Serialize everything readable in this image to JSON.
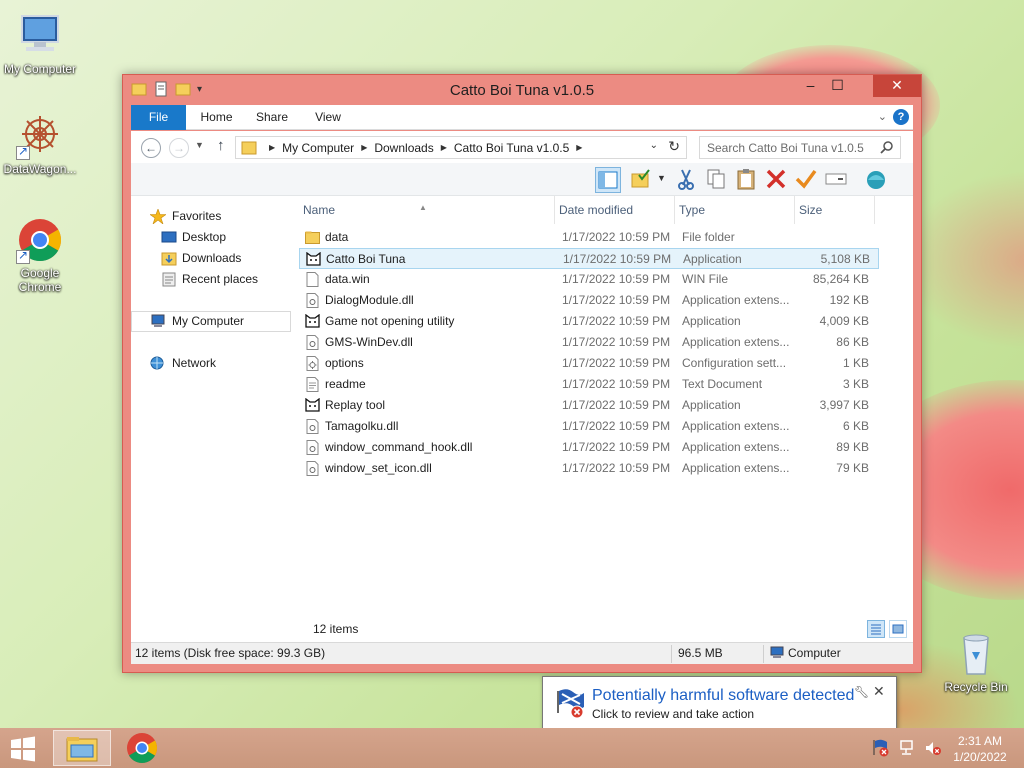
{
  "desktop": {
    "icons": [
      {
        "label": "My Computer"
      },
      {
        "label": "DataWagon..."
      },
      {
        "label": "Google Chrome"
      },
      {
        "label": "Recycle Bin"
      }
    ]
  },
  "window": {
    "title": "Catto Boi Tuna v1.0.5",
    "ribbon_tabs": [
      "File",
      "Home",
      "Share",
      "View"
    ],
    "breadcrumb": [
      "My Computer",
      "Downloads",
      "Catto Boi Tuna v1.0.5"
    ],
    "search_placeholder": "Search Catto Boi Tuna v1.0.5",
    "nav": {
      "favorites": "Favorites",
      "desktop": "Desktop",
      "downloads": "Downloads",
      "recent": "Recent places",
      "computer": "My Computer",
      "network": "Network"
    },
    "columns": [
      "Name",
      "Date modified",
      "Type",
      "Size"
    ],
    "files": [
      {
        "name": "data",
        "date": "1/17/2022 10:59 PM",
        "type": "File folder",
        "size": "",
        "icon": "folder-icon"
      },
      {
        "name": "Catto Boi Tuna",
        "date": "1/17/2022 10:59 PM",
        "type": "Application",
        "size": "5,108 KB",
        "icon": "cat-app-icon",
        "selected": true
      },
      {
        "name": "data.win",
        "date": "1/17/2022 10:59 PM",
        "type": "WIN File",
        "size": "85,264 KB",
        "icon": "blank-file-icon"
      },
      {
        "name": "DialogModule.dll",
        "date": "1/17/2022 10:59 PM",
        "type": "Application extens...",
        "size": "192 KB",
        "icon": "dll-file-icon"
      },
      {
        "name": "Game not opening utility",
        "date": "1/17/2022 10:59 PM",
        "type": "Application",
        "size": "4,009 KB",
        "icon": "cat-app-icon"
      },
      {
        "name": "GMS-WinDev.dll",
        "date": "1/17/2022 10:59 PM",
        "type": "Application extens...",
        "size": "86 KB",
        "icon": "dll-file-icon"
      },
      {
        "name": "options",
        "date": "1/17/2022 10:59 PM",
        "type": "Configuration sett...",
        "size": "1 KB",
        "icon": "config-file-icon"
      },
      {
        "name": "readme",
        "date": "1/17/2022 10:59 PM",
        "type": "Text Document",
        "size": "3 KB",
        "icon": "text-file-icon"
      },
      {
        "name": "Replay tool",
        "date": "1/17/2022 10:59 PM",
        "type": "Application",
        "size": "3,997 KB",
        "icon": "cat-app-icon"
      },
      {
        "name": "Tamagolku.dll",
        "date": "1/17/2022 10:59 PM",
        "type": "Application extens...",
        "size": "6 KB",
        "icon": "dll-file-icon"
      },
      {
        "name": "window_command_hook.dll",
        "date": "1/17/2022 10:59 PM",
        "type": "Application extens...",
        "size": "89 KB",
        "icon": "dll-file-icon"
      },
      {
        "name": "window_set_icon.dll",
        "date": "1/17/2022 10:59 PM",
        "type": "Application extens...",
        "size": "79 KB",
        "icon": "dll-file-icon"
      }
    ],
    "item_count": "12 items",
    "status": {
      "left": "12 items (Disk free space: 99.3 GB)",
      "size": "96.5 MB",
      "location": "Computer"
    }
  },
  "notification": {
    "title": "Potentially harmful software detected",
    "body": "Click to review and take action"
  },
  "taskbar": {
    "time": "2:31 AM",
    "date": "1/20/2022"
  },
  "colors": {
    "window_frame": "#ec8b82",
    "accent": "#1979ca",
    "selection": "#e5f3fb"
  }
}
